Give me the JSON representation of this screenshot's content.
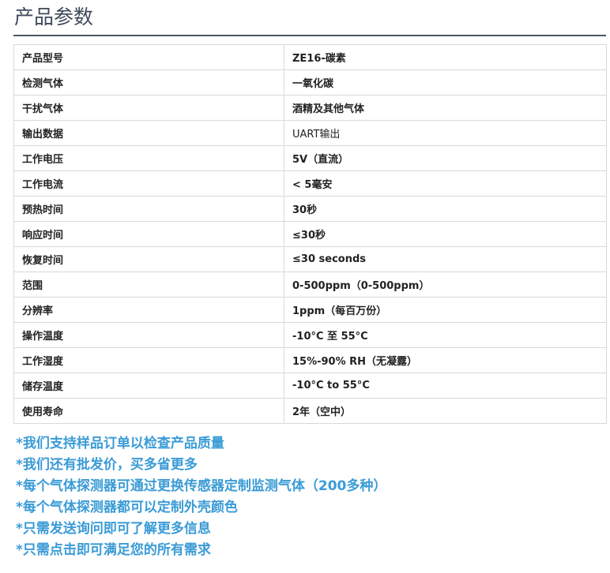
{
  "section": {
    "title": "产品参数"
  },
  "params": [
    {
      "name": "产品型号",
      "value": "ZE16-碳素"
    },
    {
      "name": "检测气体",
      "value": "一氧化碳"
    },
    {
      "name": "干扰气体",
      "value": "酒精及其他气体"
    },
    {
      "name": "输出数据",
      "value": "UART输出"
    },
    {
      "name": "工作电压",
      "value": "5V（直流）"
    },
    {
      "name": "工作电流",
      "value": "< 5毫安"
    },
    {
      "name": "预热时间",
      "value": "30秒"
    },
    {
      "name": "响应时间",
      "value": "≤30秒"
    },
    {
      "name": "恢复时间",
      "value": "≤30 seconds"
    },
    {
      "name": "范围",
      "value": "0-500ppm（0-500ppm）"
    },
    {
      "name": "分辨率",
      "value": "1ppm（每百万份）"
    },
    {
      "name": "操作温度",
      "value": "-10°C 至 55°C"
    },
    {
      "name": "工作湿度",
      "value": "15%-90% RH（无凝露）"
    },
    {
      "name": "储存温度",
      "value": "-10°C to 55°C"
    },
    {
      "name": "使用寿命",
      "value": "2年（空中）"
    }
  ],
  "notes": [
    "*我们支持样品订单以检查产品质量",
    "*我们还有批发价，买多省更多",
    "*每个气体探测器可通过更换传感器定制监测气体（200多种）",
    "*每个气体探测器都可以定制外壳颜色",
    "*只需发送询问即可了解更多信息",
    "*只需点击即可满足您的所有需求"
  ],
  "colors": {
    "title": "#3f4a5a",
    "rule": "#4f5868",
    "border": "#d9d9d9",
    "note": "#3a9bd6"
  }
}
